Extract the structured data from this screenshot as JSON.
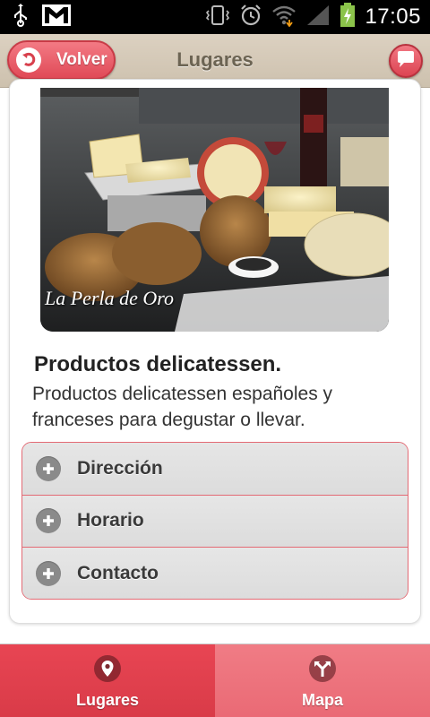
{
  "status_bar": {
    "time": "17:05",
    "icons": [
      "usb-icon",
      "gmail-icon",
      "vibrate-icon",
      "alarm-icon",
      "wifi-icon",
      "signal-icon",
      "battery-charging-icon"
    ]
  },
  "header": {
    "back_label": "Volver",
    "title": "Lugares",
    "chat_icon": "chat-bubble-icon"
  },
  "place": {
    "photo_caption": "La Perla de Oro",
    "headline": "Productos delicatessen.",
    "description": "Productos delicatessen españoles y franceses para degustar o llevar."
  },
  "accordion": {
    "items": [
      {
        "label": "Dirección",
        "icon": "plus-icon"
      },
      {
        "label": "Horario",
        "icon": "plus-icon"
      },
      {
        "label": "Contacto",
        "icon": "plus-icon"
      }
    ]
  },
  "bottom_nav": {
    "tabs": [
      {
        "label": "Lugares",
        "icon": "location-pin-icon",
        "active": true
      },
      {
        "label": "Mapa",
        "icon": "map-directions-icon",
        "active": false
      }
    ]
  },
  "colors": {
    "accent": "#e04a57",
    "header_bg": "#d6cab8",
    "accordion_border": "#e36a74"
  }
}
